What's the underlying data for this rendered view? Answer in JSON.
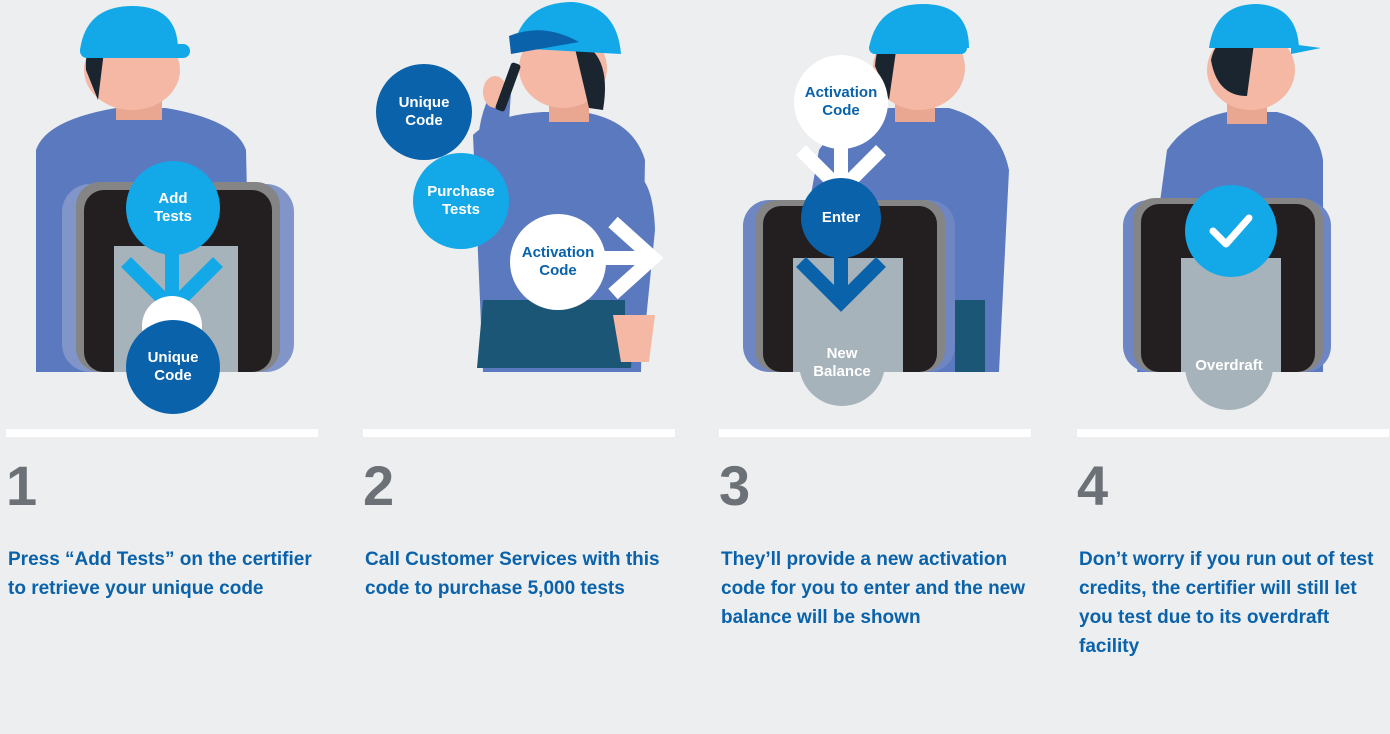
{
  "colors": {
    "background": "#eceeef",
    "number": "#6b7176",
    "text": "#0a62aa",
    "bubble_dark": "#0a62aa",
    "bubble_light": "#13a8e8",
    "bubble_grey": "#a7b3ba",
    "helmet": "#13a8e8",
    "shirt": "#5b79bf"
  },
  "steps": [
    {
      "number": "1",
      "description": "Press “Add Tests” on the certifier to retrieve your unique code",
      "bubbles": {
        "add_tests": "Add\nTests",
        "unique_code": "Unique\nCode"
      }
    },
    {
      "number": "2",
      "description": "Call Customer Services with this code to purchase 5,000 tests",
      "bubbles": {
        "unique_code": "Unique\nCode",
        "purchase_tests": "Purchase\nTests",
        "activation_code": "Activation\nCode"
      }
    },
    {
      "number": "3",
      "description": "They’ll provide a new activation code for you to enter and the new balance will be shown",
      "bubbles": {
        "activation_code": "Activation\nCode",
        "enter": "Enter",
        "new_balance": "New\nBalance"
      }
    },
    {
      "number": "4",
      "description": "Don’t worry if you run out of test credits, the certifier will still let you test due to its overdraft facility",
      "bubbles": {
        "overdraft": "Overdraft"
      },
      "icons": [
        "checkmark-icon"
      ]
    }
  ]
}
